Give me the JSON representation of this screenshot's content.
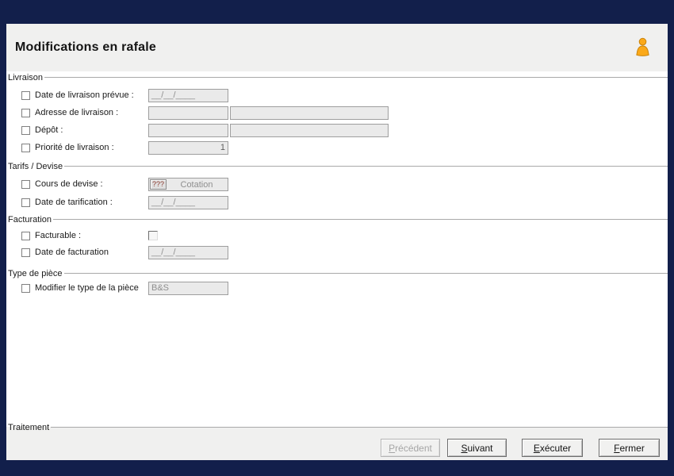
{
  "window": {
    "frame_color": "#121F4B",
    "panel_color": "#F0F0EF"
  },
  "header": {
    "title": "Modifications en rafale",
    "icon": "person-icon",
    "icon_color": "#FBA919"
  },
  "sections": {
    "livraison": {
      "label": "Livraison",
      "rows": [
        {
          "label": "Date de livraison prévue :",
          "value": "__/__/____"
        },
        {
          "label": "Adresse de livraison :",
          "value": "",
          "value2": ""
        },
        {
          "label": "Dépôt :",
          "value": "",
          "value2": ""
        },
        {
          "label": "Priorité de livraison :",
          "value": "1"
        }
      ]
    },
    "tarifs": {
      "label": "Tarifs / Devise",
      "rows": [
        {
          "label": "Cours de devise :",
          "lookup_button": "???",
          "value": "Cotation"
        },
        {
          "label": "Date de tarification :",
          "value": "__/__/____"
        }
      ]
    },
    "facturation": {
      "label": "Facturation",
      "rows": [
        {
          "label": "Facturable :",
          "value_checkbox_checked": false
        },
        {
          "label": "Date de facturation",
          "value": "__/__/____"
        }
      ]
    },
    "type_piece": {
      "label": "Type de pièce",
      "rows": [
        {
          "label": "Modifier le type de la pièce",
          "value": "B&S"
        }
      ]
    }
  },
  "footer": {
    "label": "Traitement",
    "buttons": [
      {
        "label": "Précédent",
        "disabled": true
      },
      {
        "label": "Suivant",
        "disabled": false
      },
      {
        "label": "Exécuter",
        "disabled": false
      },
      {
        "label": "Fermer",
        "disabled": false
      }
    ]
  }
}
